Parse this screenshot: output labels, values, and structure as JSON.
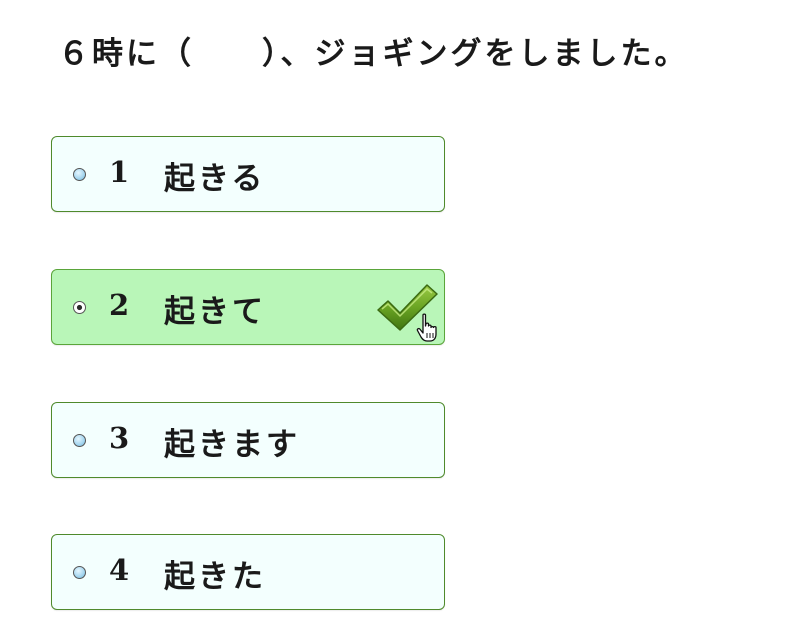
{
  "question": {
    "text": "６時に（　　）、ジョギングをしました。"
  },
  "options": [
    {
      "number": "1",
      "label": "起きる",
      "selected": false
    },
    {
      "number": "2",
      "label": "起きて",
      "selected": true
    },
    {
      "number": "3",
      "label": "起きます",
      "selected": false
    },
    {
      "number": "4",
      "label": "起きた",
      "selected": false
    }
  ],
  "colors": {
    "option_background": "#f3fffe",
    "option_border": "#4f8a2c",
    "selected_background": "#b9f6b8",
    "checkmark": "#5c8f1c"
  },
  "icons": {
    "checkmark": "checkmark-icon",
    "cursor": "hand-pointer-icon",
    "radio": "radio-icon"
  }
}
